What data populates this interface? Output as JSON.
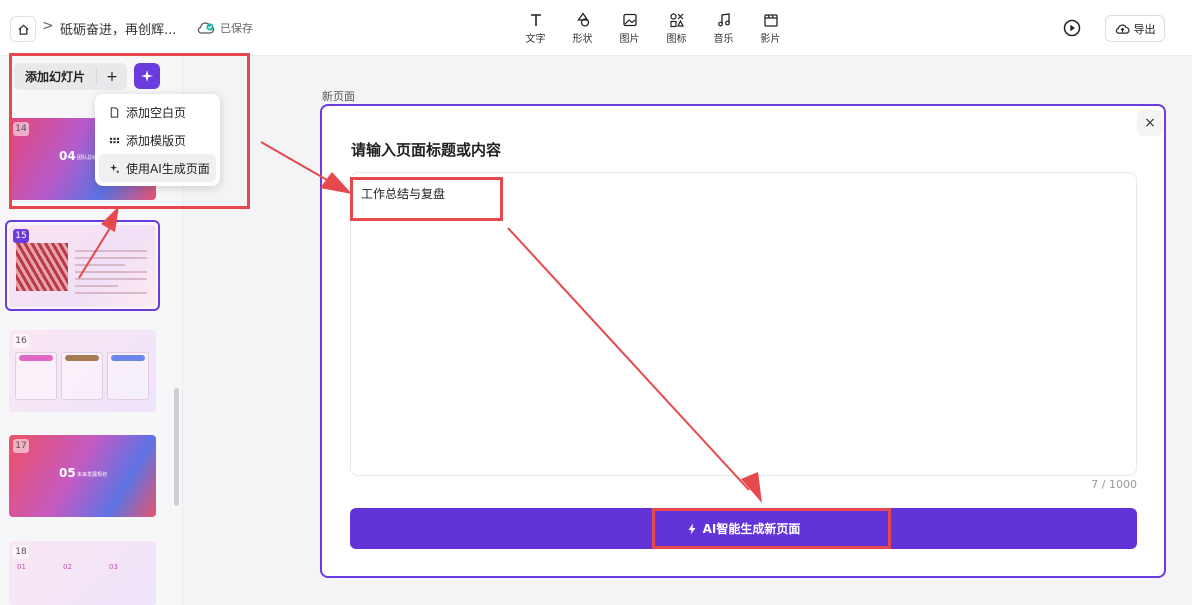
{
  "header": {
    "doc_title": "砥砺奋进，再创辉...",
    "breadcrumb_sep": ">",
    "save_status": "已保存",
    "tools": [
      {
        "label": "文字",
        "icon": "text-icon"
      },
      {
        "label": "形状",
        "icon": "shape-icon"
      },
      {
        "label": "图片",
        "icon": "image-icon"
      },
      {
        "label": "图标",
        "icon": "icon-library-icon"
      },
      {
        "label": "音乐",
        "icon": "music-icon"
      },
      {
        "label": "影片",
        "icon": "video-icon"
      }
    ],
    "export_label": "导出"
  },
  "sidebar": {
    "add_slide_label": "添加幻灯片",
    "add_plus": "+",
    "menu": [
      {
        "label": "添加空白页",
        "icon": "blank-page-icon"
      },
      {
        "label": "添加模版页",
        "icon": "template-grid-icon"
      },
      {
        "label": "使用AI生成页面",
        "icon": "ai-sparkle-icon"
      }
    ],
    "slides": [
      {
        "num": "14",
        "big": "04",
        "caption": "团队总结"
      },
      {
        "num": "15"
      },
      {
        "num": "16"
      },
      {
        "num": "17",
        "big": "05",
        "caption": "未来发展规划"
      },
      {
        "num": "18",
        "cols": [
          "01",
          "02",
          "03"
        ]
      }
    ]
  },
  "main": {
    "page_label": "新页面",
    "dialog": {
      "title": "请输入页面标题或内容",
      "input_value": "工作总结与复盘",
      "counter": "7 / 1000",
      "close": "×",
      "generate_label": "AI智能生成新页面"
    }
  },
  "colors": {
    "accent": "#6a3ce0",
    "button": "#6233d9",
    "annotation": "#e5484d"
  }
}
